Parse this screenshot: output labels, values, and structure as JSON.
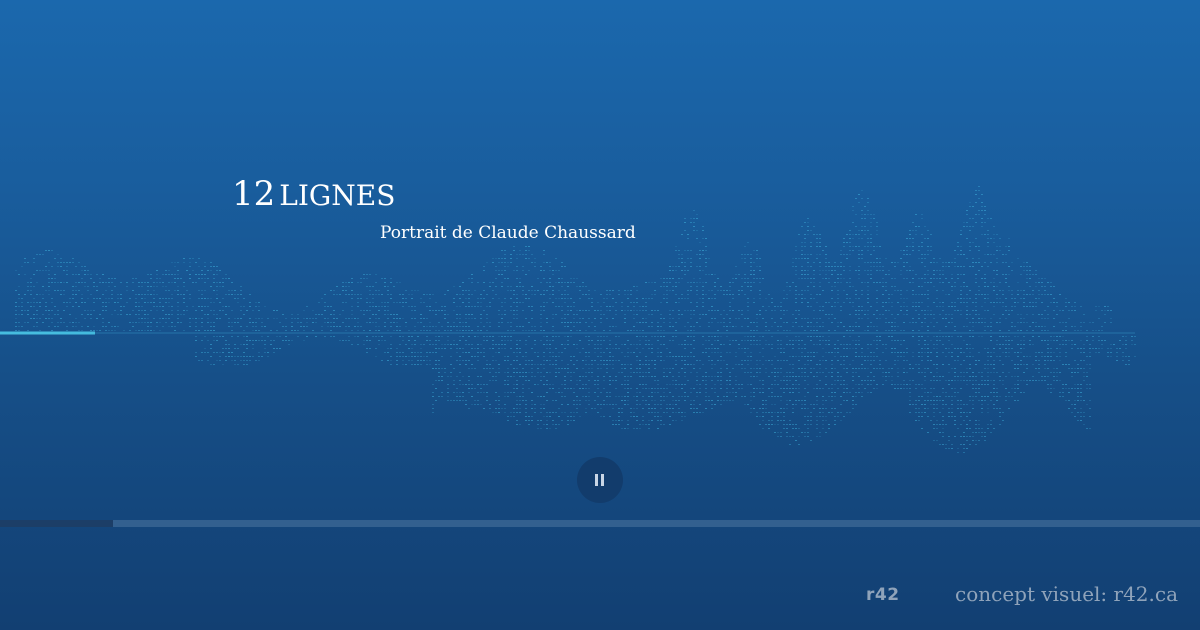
{
  "title": {
    "number": "12",
    "word": "LIGNES"
  },
  "subtitle": "Portrait de Claude Chaussard",
  "player": {
    "state": "playing",
    "pause_icon": "pause-icon",
    "progress": 0.094
  },
  "footer": {
    "logo_text": "r42",
    "credit": "concept visuel: r42.ca"
  },
  "colors": {
    "background_top": "#1b68ad",
    "background_bottom": "#123f72",
    "waveform": "#3fb3de",
    "waveform_played": "#4cc9e8",
    "progress_track": "#33608f",
    "progress_fill": "#1c3e67",
    "footer_text": "#8fa3ba"
  }
}
